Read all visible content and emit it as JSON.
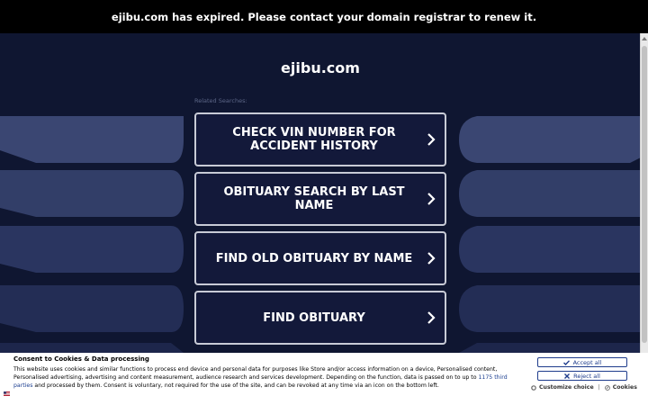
{
  "banner": {
    "text": "ejibu.com has expired. Please contact your domain registrar to renew it."
  },
  "site": {
    "title": "ejibu.com",
    "related_label": "Related Searches:"
  },
  "searches": [
    {
      "label": "CHECK VIN NUMBER FOR ACCIDENT HISTORY"
    },
    {
      "label": "OBITUARY SEARCH BY LAST NAME"
    },
    {
      "label": "FIND OLD OBITUARY BY NAME"
    },
    {
      "label": "FIND OBITUARY"
    }
  ],
  "consent": {
    "title": "Consent to Cookies & Data processing",
    "text_before_link": "This website uses cookies and similar functions to process end device and personal data for purposes like Store and/or access information on a device, Personalised content, Personalised advertising, advertising and content measurement, audience research and services development. Depending on the function, data is passed on to up to ",
    "link_text": "1175 third parties",
    "text_after_link": " and processed by them. Consent is voluntary, not required for the use of the site, and can be revoked at any time via an icon on the bottom left.",
    "accept_label": "Accept all",
    "reject_label": "Reject all",
    "customize_label": "Customize choice",
    "separator": "|",
    "cookies_label": "Cookies"
  },
  "colors": {
    "background": "#0f1631",
    "button_bg": "#13193a",
    "button_border": "#c8cbd6",
    "accent": "#1e3c8c"
  }
}
